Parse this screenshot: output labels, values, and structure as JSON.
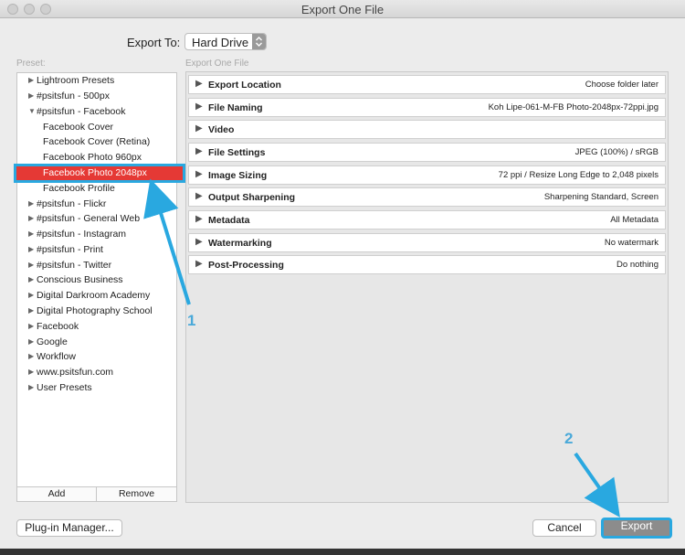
{
  "window": {
    "title": "Export One File"
  },
  "export_to": {
    "label": "Export To:",
    "value": "Hard Drive"
  },
  "preset": {
    "label": "Preset:",
    "items": [
      {
        "label": "Lightroom Presets",
        "expandable": true,
        "expanded": false,
        "level": 0
      },
      {
        "label": "#psitsfun - 500px",
        "expandable": true,
        "expanded": false,
        "level": 0
      },
      {
        "label": "#psitsfun - Facebook",
        "expandable": true,
        "expanded": true,
        "level": 0
      },
      {
        "label": "Facebook Cover",
        "expandable": false,
        "level": 1
      },
      {
        "label": "Facebook Cover (Retina)",
        "expandable": false,
        "level": 1
      },
      {
        "label": "Facebook Photo 960px",
        "expandable": false,
        "level": 1
      },
      {
        "label": "Facebook Photo 2048px",
        "expandable": false,
        "level": 1,
        "selected": true
      },
      {
        "label": "Facebook Profile",
        "expandable": false,
        "level": 1
      },
      {
        "label": "#psitsfun - Flickr",
        "expandable": true,
        "expanded": false,
        "level": 0
      },
      {
        "label": "#psitsfun - General Web",
        "expandable": true,
        "expanded": false,
        "level": 0
      },
      {
        "label": "#psitsfun - Instagram",
        "expandable": true,
        "expanded": false,
        "level": 0
      },
      {
        "label": "#psitsfun - Print",
        "expandable": true,
        "expanded": false,
        "level": 0
      },
      {
        "label": "#psitsfun - Twitter",
        "expandable": true,
        "expanded": false,
        "level": 0
      },
      {
        "label": "Conscious Business",
        "expandable": true,
        "expanded": false,
        "level": 0
      },
      {
        "label": "Digital Darkroom Academy",
        "expandable": true,
        "expanded": false,
        "level": 0
      },
      {
        "label": "Digital Photography School",
        "expandable": true,
        "expanded": false,
        "level": 0
      },
      {
        "label": "Facebook",
        "expandable": true,
        "expanded": false,
        "level": 0
      },
      {
        "label": "Google",
        "expandable": true,
        "expanded": false,
        "level": 0
      },
      {
        "label": "Workflow",
        "expandable": true,
        "expanded": false,
        "level": 0
      },
      {
        "label": "www.psitsfun.com",
        "expandable": true,
        "expanded": false,
        "level": 0
      },
      {
        "label": "User Presets",
        "expandable": true,
        "expanded": false,
        "level": 0
      }
    ],
    "add_label": "Add",
    "remove_label": "Remove"
  },
  "export_panel": {
    "label": "Export One File",
    "sections": [
      {
        "name": "Export Location",
        "value": "Choose folder later"
      },
      {
        "name": "File Naming",
        "value": "Koh Lipe-061-M-FB Photo-2048px-72ppi.jpg"
      },
      {
        "name": "Video",
        "value": ""
      },
      {
        "name": "File Settings",
        "value": "JPEG (100%) / sRGB"
      },
      {
        "name": "Image Sizing",
        "value": "72 ppi / Resize Long Edge to 2,048 pixels"
      },
      {
        "name": "Output Sharpening",
        "value": "Sharpening Standard, Screen"
      },
      {
        "name": "Metadata",
        "value": "All Metadata"
      },
      {
        "name": "Watermarking",
        "value": "No watermark"
      },
      {
        "name": "Post-Processing",
        "value": "Do nothing"
      }
    ]
  },
  "buttons": {
    "plugin_manager": "Plug-in Manager...",
    "cancel": "Cancel",
    "export": "Export"
  },
  "annotations": {
    "one": "1",
    "two": "2"
  },
  "colors": {
    "selected_preset": "#e53935",
    "annotation": "#29a8e0",
    "export_button": "#8c8c8c"
  }
}
